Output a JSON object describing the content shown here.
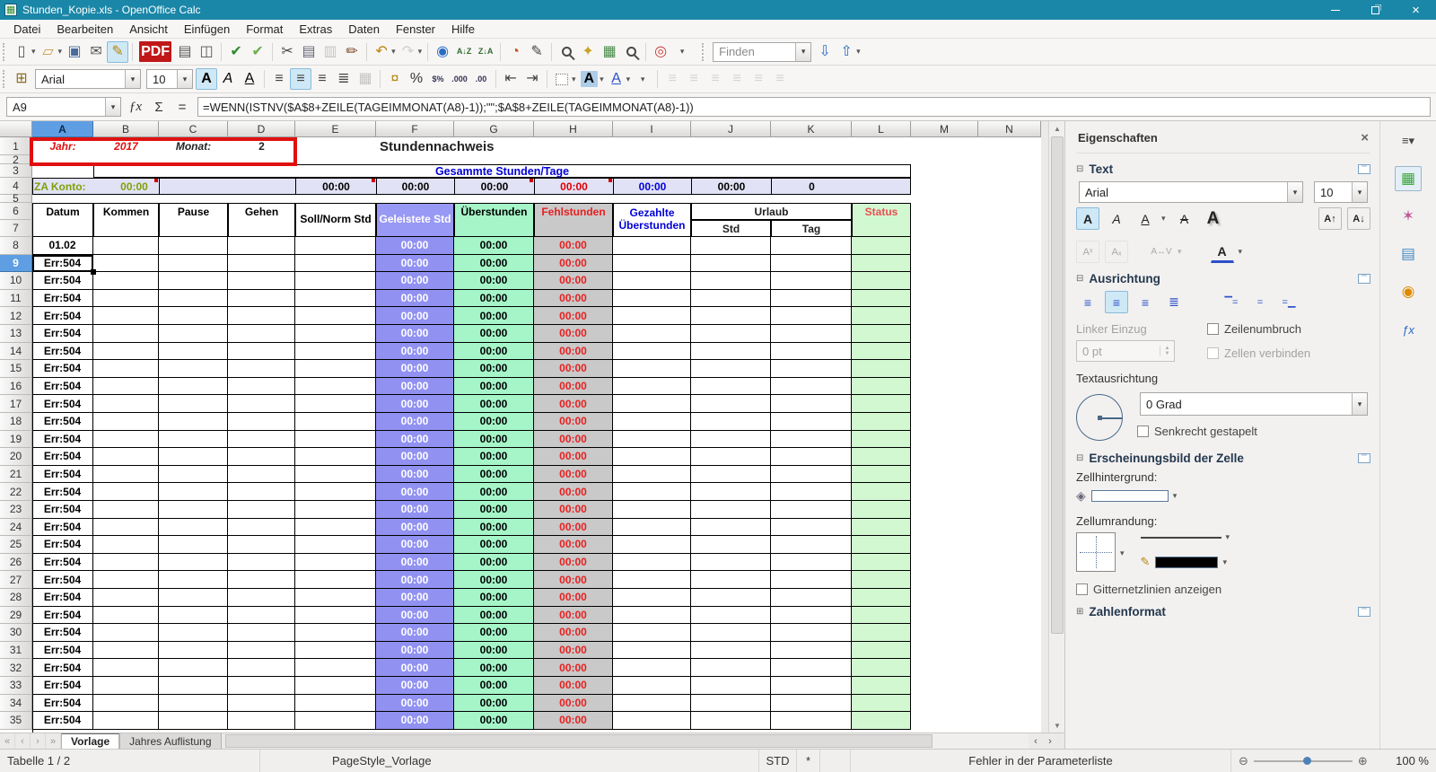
{
  "window": {
    "title": "Stunden_Kopie.xls - OpenOffice Calc"
  },
  "menubar": {
    "items": [
      "Datei",
      "Bearbeiten",
      "Ansicht",
      "Einfügen",
      "Format",
      "Extras",
      "Daten",
      "Fenster",
      "Hilfe"
    ]
  },
  "toolbar_standard": {
    "items": [
      {
        "name": "new-document",
        "glyph": "▯",
        "color": "#555",
        "dropdown": true
      },
      {
        "name": "open",
        "glyph": "▱",
        "color": "#c89a3c",
        "dropdown": true
      },
      {
        "name": "save",
        "glyph": "▣",
        "color": "#4a6b9c"
      },
      {
        "name": "email",
        "glyph": "✉",
        "color": "#555"
      },
      {
        "name": "edit-mode",
        "glyph": "✎",
        "color": "#b8860b",
        "active": true
      },
      {
        "sep": true
      },
      {
        "name": "export-pdf",
        "glyph": "PDF",
        "pdf": true
      },
      {
        "name": "print",
        "glyph": "▤",
        "color": "#555"
      },
      {
        "name": "page-preview",
        "glyph": "◫",
        "color": "#555"
      },
      {
        "sep": true
      },
      {
        "name": "spellcheck",
        "glyph": "✔",
        "color": "#2e8b2e"
      },
      {
        "name": "auto-spellcheck",
        "glyph": "✔",
        "color": "#6fae4e"
      },
      {
        "sep": true
      },
      {
        "name": "cut",
        "glyph": "✂",
        "color": "#444"
      },
      {
        "name": "copy",
        "glyph": "▤",
        "color": "#667"
      },
      {
        "name": "paste",
        "glyph": "▥",
        "color": "#667",
        "disabled": true
      },
      {
        "name": "format-paintbrush",
        "glyph": "✏",
        "color": "#7a4a2a"
      },
      {
        "sep": true
      },
      {
        "name": "undo",
        "glyph": "↶",
        "color": "#b8860b",
        "dropdown": true
      },
      {
        "name": "redo",
        "glyph": "↷",
        "color": "#888",
        "disabled": true,
        "dropdown": true
      },
      {
        "sep": true
      },
      {
        "name": "hyperlink",
        "glyph": "◉",
        "color": "#2a6bc4"
      },
      {
        "name": "sort-ascending",
        "glyph": "A↓Z",
        "small": true,
        "color": "#2e6b2e"
      },
      {
        "name": "sort-descending",
        "glyph": "Z↓A",
        "small": true,
        "color": "#2e6b2e"
      },
      {
        "sep": true
      },
      {
        "name": "insert-chart",
        "glyph": "◔",
        "color": "#c44818"
      },
      {
        "name": "show-draw-functions",
        "glyph": "✎",
        "color": "#444"
      },
      {
        "sep": true
      },
      {
        "name": "find-replace",
        "css": "mag"
      },
      {
        "name": "navigator",
        "glyph": "✦",
        "color": "#c9a227"
      },
      {
        "name": "gallery",
        "glyph": "▦",
        "color": "#4a8b4a"
      },
      {
        "name": "zoom",
        "css": "mag"
      },
      {
        "sep": true
      },
      {
        "name": "help",
        "glyph": "◎",
        "color": "#c43a3a"
      },
      {
        "name": "standard-toolbar-more",
        "glyph": "▾",
        "small": true,
        "color": "#555"
      }
    ]
  },
  "find_bar": {
    "placeholder": "Finden",
    "next_glyph": "⇩",
    "prev_glyph": "⇧",
    "more_glyph": "▾"
  },
  "toolbar_formatting": {
    "items": [
      {
        "name": "cell-format",
        "glyph": "⊞",
        "color": "#8a6d1f"
      },
      {
        "combo": true,
        "name": "font-name",
        "value": "Arial",
        "w": 118
      },
      {
        "combo": true,
        "name": "font-size",
        "value": "10",
        "w": 52
      },
      {
        "name": "bold",
        "glyph": "A",
        "color": "#000",
        "cls": "b",
        "active": true
      },
      {
        "name": "italic",
        "glyph": "A",
        "color": "#000",
        "cls": "i"
      },
      {
        "name": "underline",
        "glyph": "A",
        "color": "#000",
        "cls": "u"
      },
      {
        "sep": true
      },
      {
        "name": "align-left",
        "glyph": "≡",
        "color": "#444"
      },
      {
        "name": "align-center",
        "glyph": "≡",
        "color": "#444",
        "active": true
      },
      {
        "name": "align-right",
        "glyph": "≡",
        "color": "#444"
      },
      {
        "name": "align-justify",
        "glyph": "≣",
        "color": "#444"
      },
      {
        "name": "merge-cells",
        "glyph": "▦",
        "color": "#667",
        "disabled": true
      },
      {
        "sep": true
      },
      {
        "name": "format-currency",
        "glyph": "¤",
        "color": "#b8860b"
      },
      {
        "name": "format-percent",
        "glyph": "%",
        "color": "#333"
      },
      {
        "name": "format-standard",
        "glyph": "$%",
        "small": true,
        "color": "#335"
      },
      {
        "name": "add-decimal",
        "glyph": ".000",
        "small": true,
        "color": "#335"
      },
      {
        "name": "delete-decimal",
        "glyph": ".00",
        "small": true,
        "color": "#335"
      },
      {
        "sep": true
      },
      {
        "name": "decrease-indent",
        "glyph": "⇤",
        "color": "#444"
      },
      {
        "name": "increase-indent",
        "glyph": "⇥",
        "color": "#444"
      },
      {
        "sep": true
      },
      {
        "name": "borders",
        "css": "borderbox",
        "dropdown": true
      },
      {
        "name": "background-color",
        "glyph": "A",
        "chip": "#aecdе8",
        "color": "#000",
        "dropdown": true
      },
      {
        "name": "font-color",
        "glyph": "A",
        "color": "#2a50c8",
        "cls": "u",
        "dropdown": true
      },
      {
        "name": "formatting-toolbar-more",
        "glyph": "▾",
        "small": true,
        "color": "#555"
      },
      {
        "sep": true
      },
      {
        "name": "align-objects-left",
        "glyph": "≡",
        "color": "#999",
        "disabled": true
      },
      {
        "name": "center-objects-horizontal",
        "glyph": "≡",
        "color": "#999",
        "disabled": true
      },
      {
        "name": "align-objects-right",
        "glyph": "≡",
        "color": "#999",
        "disabled": true
      },
      {
        "name": "align-objects-top",
        "glyph": "≡",
        "color": "#999",
        "disabled": true
      },
      {
        "name": "center-objects-vertical",
        "glyph": "≡",
        "color": "#999",
        "disabled": true
      },
      {
        "name": "align-objects-bottom",
        "glyph": "≡",
        "color": "#999",
        "disabled": true
      }
    ]
  },
  "formula_bar": {
    "cell_reference": "A9",
    "fx_glyph": "ƒx",
    "sum_glyph": "Σ",
    "equals_glyph": "=",
    "formula": "=WENN(ISTNV($A$8+ZEILE(TAGEIMMONAT(A8)-1));\"\";$A$8+ZEILE(TAGEIMMONAT(A8)-1))"
  },
  "grid": {
    "columns": [
      "A",
      "B",
      "C",
      "D",
      "E",
      "F",
      "G",
      "H",
      "I",
      "J",
      "K",
      "L",
      "M",
      "N"
    ],
    "selected_column": "A",
    "selected_row": 9,
    "first_row": 1,
    "last_row": 35,
    "banner": {
      "jahr_label": "Jahr:",
      "jahr_value": "2017",
      "monat_label": "Monat:",
      "monat_value": "2"
    },
    "title": "Stundennachweis",
    "summary_title": "Gesammte Stunden/Tage",
    "za_konto_label": "ZA Konto:",
    "za_konto_value": "00:00",
    "summary_cells": [
      {
        "col": "E",
        "text": "00:00",
        "color": "#000000"
      },
      {
        "col": "F",
        "text": "00:00",
        "color": "#000000"
      },
      {
        "col": "G",
        "text": "00:00",
        "color": "#000000"
      },
      {
        "col": "H",
        "text": "00:00",
        "color": "#e00000"
      },
      {
        "col": "I",
        "text": "00:00",
        "color": "#0000d6"
      },
      {
        "col": "J",
        "text": "00:00",
        "color": "#000000"
      },
      {
        "col": "K",
        "text": "0",
        "color": "#000000"
      }
    ],
    "comment_marker_cols": [
      "B",
      "E",
      "G",
      "H"
    ],
    "table": {
      "headers": {
        "datum": "Datum",
        "kommen": "Kommen",
        "pause": "Pause",
        "gehen": "Gehen",
        "soll": "Soll/Norm Std",
        "geleistete": "Geleistete Std",
        "ueberstunden": "Überstunden",
        "fehlstunden": "Fehlstunden",
        "gezahlte": "Gezahlte Überstunden",
        "urlaub": "Urlaub",
        "std": "Std",
        "tag": "Tag",
        "status": "Status"
      },
      "first_date": "01.02",
      "error_value": "Err:504",
      "time_value": "00:00",
      "data_first_row": 8,
      "data_last_row": 35
    }
  },
  "colors": {
    "title_bar": "#1a87a8",
    "col_f_bg": "#9191f2",
    "col_f_header_bg": "#9898f5",
    "col_g_bg": "#a5f5c8",
    "col_h_bg": "#c9c9c9",
    "col_h_text": "#e82020",
    "col_l_bg": "#d2f8d2",
    "status_text": "#e85050",
    "summary_band_bg": "#e2e2f6",
    "banner_red": "#e01010",
    "blue_text": "#0000d6",
    "green_label": "#7fa007",
    "selection_header": "#5f9ee2"
  },
  "sheet_tabs": {
    "tabs": [
      "Vorlage",
      "Jahres Auflistung"
    ],
    "active_index": 0
  },
  "status_bar": {
    "sheet_info": "Tabelle 1 / 2",
    "page_style": "PageStyle_Vorlage",
    "mode": "STD",
    "modified_flag": "*",
    "message": "Fehler in der Parameterliste",
    "zoom_value": "100 %"
  },
  "sidebar": {
    "title": "Eigenschaften",
    "text_section": {
      "title": "Text",
      "font_name": "Arial",
      "font_size": "10",
      "bold_glyph": "A",
      "italic_glyph": "A",
      "underline_glyph": "A",
      "strike_glyph": "A",
      "shadow_glyph": "A",
      "grow_glyph": "A↑",
      "shrink_glyph": "A↓",
      "superscript_glyph": "Aˣ",
      "subscript_glyph": "Aₓ",
      "spacing_glyph": "A↔V",
      "fontcolor_glyph": "A"
    },
    "alignment_section": {
      "title": "Ausrichtung",
      "left_indent_label": "Linker Einzug",
      "left_indent_value": "0 pt",
      "wrap_label": "Zeilenumbruch",
      "merge_label": "Zellen verbinden",
      "orientation_label": "Textausrichtung",
      "degrees_value": "0 Grad",
      "stacked_label": "Senkrecht gestapelt"
    },
    "cell_section": {
      "title": "Erscheinungsbild der Zelle",
      "background_label": "Zellhintergrund:",
      "border_label": "Zellumrandung:",
      "gridlines_label": "Gitternetzlinien anzeigen"
    },
    "number_section": {
      "title": "Zahlenformat"
    }
  }
}
